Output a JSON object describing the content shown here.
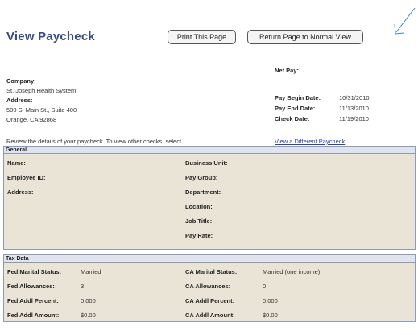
{
  "header": {
    "title": "View Paycheck",
    "print_button": "Print This Page",
    "return_button": "Return Page to Normal View"
  },
  "company": {
    "company_label": "Company:",
    "company_name": "St. Joseph Health System",
    "address_label": "Address:",
    "address_line1": "500 S. Main St., Suite 400",
    "address_line2": "Orange, CA 92868"
  },
  "pay_summary": {
    "net_pay_label": "Net Pay:",
    "begin_label": "Pay Begin Date:",
    "begin_value": "10/31/2010",
    "end_label": "Pay End Date:",
    "end_value": "11/13/2010",
    "check_label": "Check Date:",
    "check_value": "11/19/2010"
  },
  "review_text": "Review the details of your paycheck.  To view other checks, select",
  "view_different_link": "View a Different Paycheck",
  "general": {
    "title": "General",
    "left_labels": [
      "Name:",
      "Employee ID:",
      "Address:"
    ],
    "right_labels": [
      "Business Unit:",
      "Pay Group:",
      "Department:",
      "Location:",
      "Job Title:",
      "Pay Rate:"
    ]
  },
  "tax_data": {
    "title": "Tax Data",
    "federal": [
      {
        "label": "Fed Marital Status:",
        "value": "Married"
      },
      {
        "label": "Fed Allowances:",
        "value": "3"
      },
      {
        "label": "Fed Addl Percent:",
        "value": "0.000"
      },
      {
        "label": "Fed Addl Amount:",
        "value": "$0.00"
      }
    ],
    "state": [
      {
        "label": "CA Marital Status:",
        "value": "Married (one income)"
      },
      {
        "label": "CA Allowances:",
        "value": "0"
      },
      {
        "label": "CA Addl Percent:",
        "value": "0.000"
      },
      {
        "label": "CA Addl Amount:",
        "value": "$0.00"
      }
    ]
  },
  "colors": {
    "title": "#3a4a8a",
    "section_fill": "#e9e4d6",
    "section_header": "#dfe4ef",
    "link": "#2a3fc4",
    "arrow": "#3f7fd0"
  },
  "icons": {
    "corner": "diagonal-arrow-icon"
  }
}
